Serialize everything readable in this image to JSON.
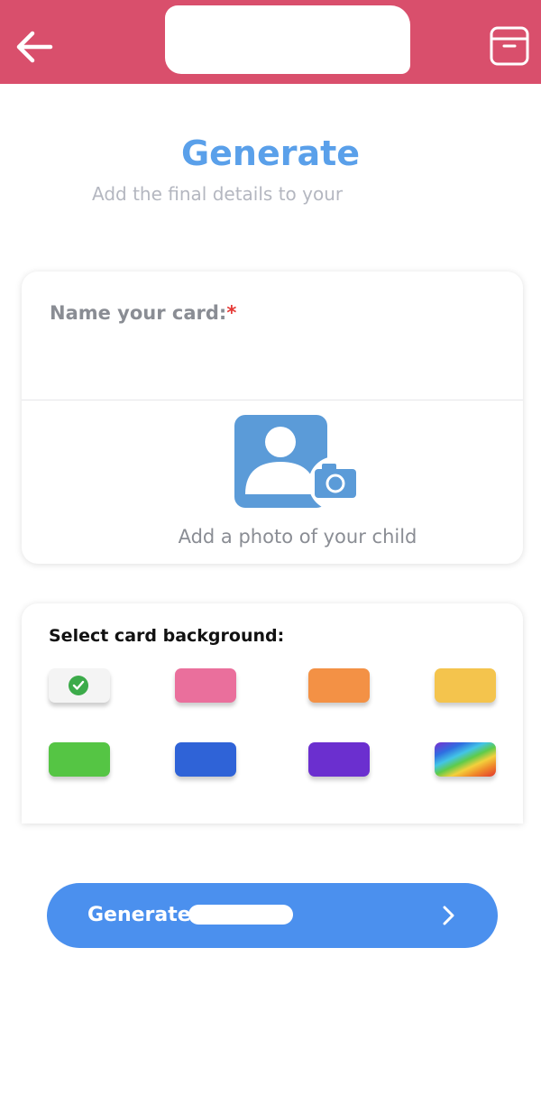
{
  "header": {
    "back_icon": "arrow-left-icon",
    "archive_icon": "archive-box-icon",
    "background": "#d94f6c"
  },
  "main": {
    "title": "Generate",
    "subtitle": "Add the final details to your"
  },
  "name_card": {
    "label": "Name your card:",
    "required_mark": "*",
    "input_value": "",
    "photo_icon": "person-photo-camera-icon",
    "photo_label": "Add a photo of your child"
  },
  "background_card": {
    "label": "Select card background:",
    "selected_index": 0,
    "swatches": [
      {
        "name": "white",
        "color": "#f4f4f4"
      },
      {
        "name": "pink",
        "color": "#ea6f9c"
      },
      {
        "name": "orange",
        "color": "#f39145"
      },
      {
        "name": "yellow",
        "color": "#f4c44d"
      },
      {
        "name": "green",
        "color": "#55c544"
      },
      {
        "name": "blue",
        "color": "#2f63d7"
      },
      {
        "name": "purple",
        "color": "#6b2fcf"
      },
      {
        "name": "rainbow",
        "color": "rainbow-gradient"
      }
    ]
  },
  "generate_button": {
    "label": "Generate",
    "chevron_icon": "chevron-right-icon",
    "color": "#4b90ee"
  }
}
